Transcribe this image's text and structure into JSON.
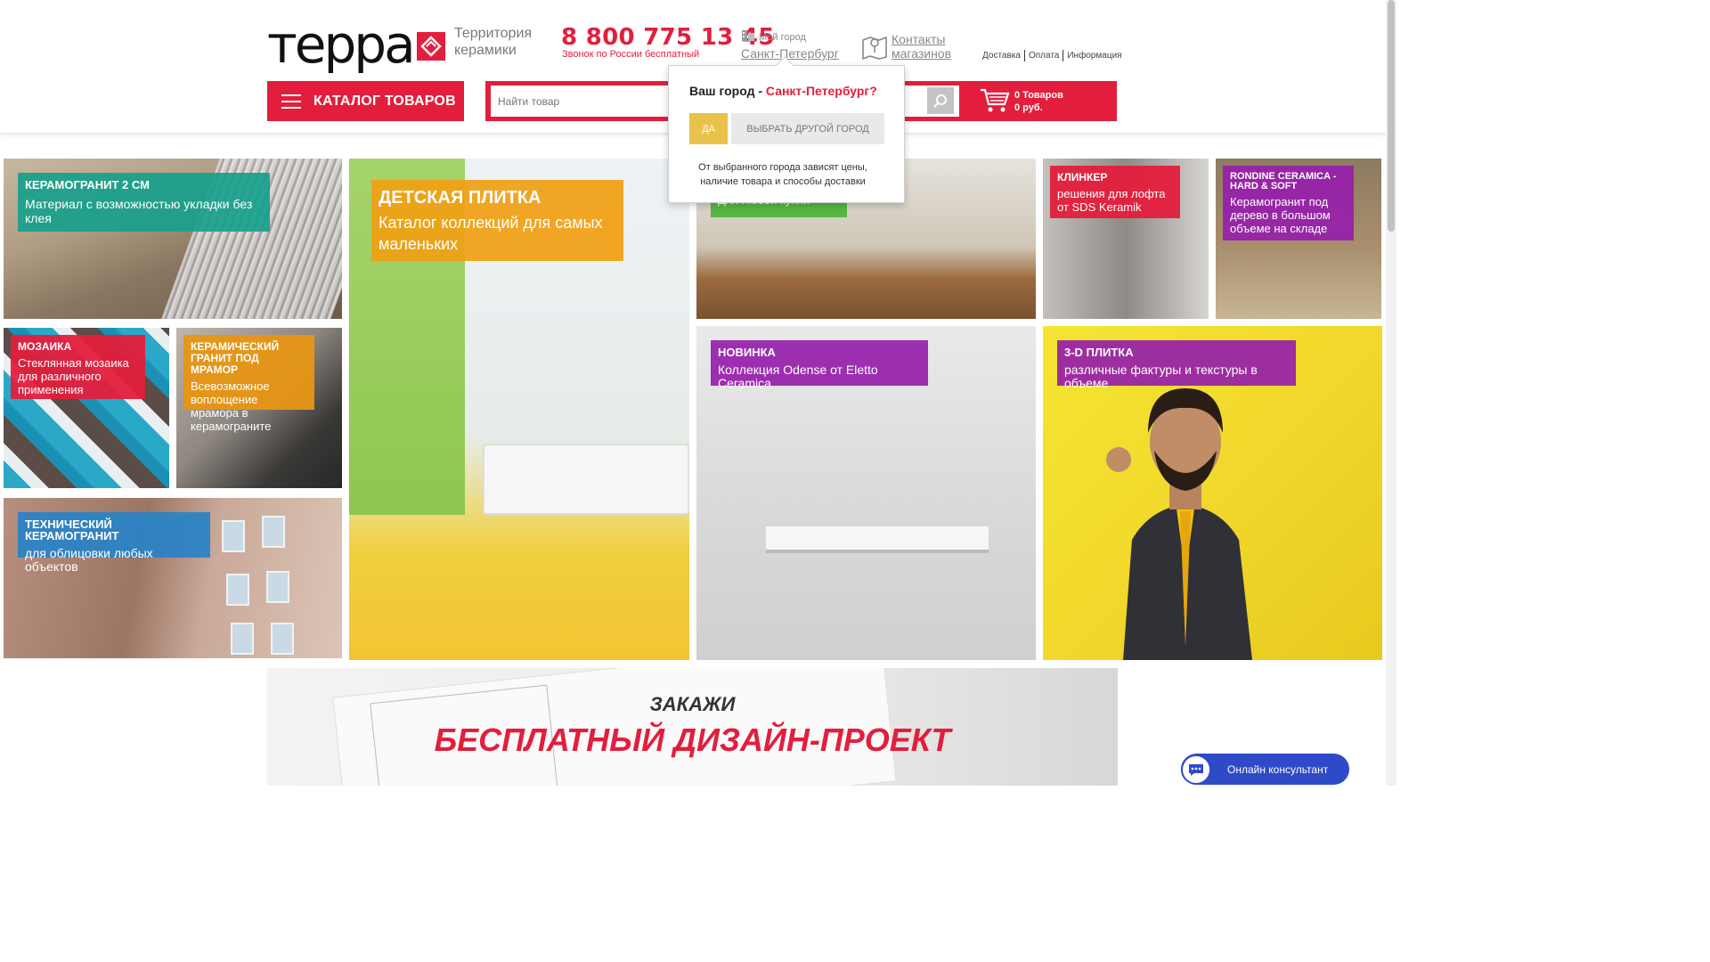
{
  "header": {
    "logo_text": "терра",
    "tagline": "Территория керамики",
    "phone": "8 800 775 13 45",
    "phone_note": "Звонок по России бесплатный",
    "city_label": "Мой город",
    "city_name": "Санкт-Петербург",
    "contacts": "Контакты магазинов",
    "links": [
      "Доставка",
      "Оплата",
      "Информация"
    ]
  },
  "nav": {
    "catalog_label": "КАТАЛОГ ТОВАРОВ",
    "search_placeholder": "Найти товар",
    "cart_count": "0 Товаров",
    "cart_sum": "0 руб."
  },
  "popup": {
    "question": "Ваш город - ",
    "question_city": "Санкт-Петербург?",
    "yes": "ДА",
    "other": "ВЫБРАТЬ ДРУГОЙ ГОРОД",
    "note": "От выбранного города зависят цены, наличие товара и способы доставки"
  },
  "tiles": [
    {
      "title": "КЕРАМОГРАНИТ 2 СМ",
      "subtitle": "Материал с возможностью укладки без клея"
    },
    {
      "title": "МОЗАИКА",
      "subtitle": "Стеклянная мозаика для различного применения"
    },
    {
      "title": "КЕРАМИЧЕСКИЙ ГРАНИТ ПОД МРАМОР",
      "subtitle": "Всевозможное воплощение мрамора в керамограните"
    },
    {
      "title": "ТЕХНИЧЕСКИЙ КЕРАМОГРАНИТ",
      "subtitle": "для облицовки любых объектов"
    },
    {
      "title": "ДЕТСКАЯ ПЛИТКА",
      "subtitle": "Каталог коллекций для самых маленьких"
    },
    {
      "title": "",
      "subtitle": "Для любой кухни"
    },
    {
      "title": "КЛИНКЕР",
      "subtitle": "решения для лофта от SDS Keramik"
    },
    {
      "title": "RONDINE CERAMICA - HARD & SOFT",
      "subtitle": "Керамогранит под дерево в большом объеме на складе"
    },
    {
      "title": "НОВИНКА",
      "subtitle": "Коллекция Odense от Eletto Ceramica"
    },
    {
      "title": "3-D ПЛИТКА",
      "subtitle": "различные фактуры и текстуры в объеме"
    }
  ],
  "promo": {
    "line1": "ЗАКАЖИ",
    "line2": "БЕСПЛАТНЫЙ ДИЗАЙН-ПРОЕКТ"
  },
  "consult": {
    "label": "Онлайн консультант"
  },
  "colors": {
    "accent": "#e31e3c",
    "popup_yes": "#e8c24a",
    "consult": "#2f4ac8"
  }
}
